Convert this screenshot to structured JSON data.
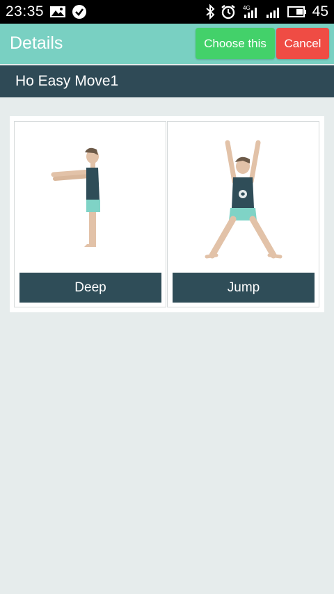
{
  "status_bar": {
    "time": "23:35",
    "battery": "45",
    "network": "4G",
    "icons": [
      "image-icon",
      "check-circle-icon",
      "bluetooth-icon",
      "alarm-icon",
      "signal-icon",
      "signal-icon",
      "battery-icon"
    ]
  },
  "header": {
    "title": "Details",
    "choose_label": "Choose this",
    "cancel_label": "Cancel"
  },
  "subheader": {
    "title": "Ho Easy Move1"
  },
  "exercises": [
    {
      "label": "Deep"
    },
    {
      "label": "Jump"
    }
  ],
  "colors": {
    "header_bg": "#79d0c2",
    "subheader_bg": "#2f4a56",
    "choose_bg": "#43d16a",
    "cancel_bg": "#ef4c44",
    "page_bg": "#e6ecec"
  }
}
